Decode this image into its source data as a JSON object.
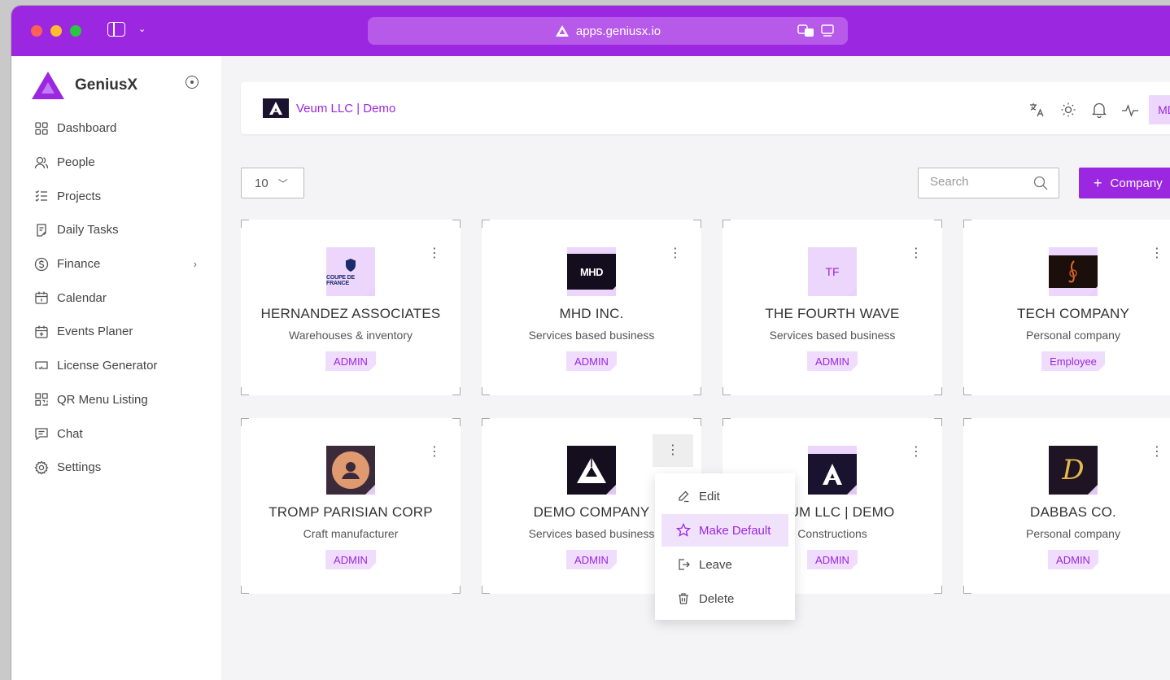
{
  "browser": {
    "url": "apps.geniusx.io"
  },
  "sidebar": {
    "brand": "GeniusX",
    "items": [
      {
        "label": "Dashboard",
        "icon": "dashboard-icon"
      },
      {
        "label": "People",
        "icon": "people-icon"
      },
      {
        "label": "Projects",
        "icon": "projects-icon"
      },
      {
        "label": "Daily Tasks",
        "icon": "daily-tasks-icon"
      },
      {
        "label": "Finance",
        "icon": "finance-icon"
      },
      {
        "label": "Calendar",
        "icon": "calendar-icon"
      },
      {
        "label": "Events Planer",
        "icon": "events-icon"
      },
      {
        "label": "License Generator",
        "icon": "license-icon"
      },
      {
        "label": "QR Menu Listing",
        "icon": "qr-icon"
      },
      {
        "label": "Chat",
        "icon": "chat-icon"
      },
      {
        "label": "Settings",
        "icon": "settings-icon"
      }
    ]
  },
  "topbar": {
    "org_name": "Veum LLC | Demo",
    "avatar": "MD"
  },
  "toolbar": {
    "per_page": "10",
    "search_placeholder": "Search",
    "add_label": "Company"
  },
  "cards": [
    {
      "name": "HERNANDEZ ASSOCIATES",
      "type": "Warehouses & inventory",
      "role": "ADMIN",
      "logo_text": "COUPE DE FRANCE"
    },
    {
      "name": "MHD INC.",
      "type": "Services based business",
      "role": "ADMIN",
      "logo_text": "MHD"
    },
    {
      "name": "THE FOURTH WAVE",
      "type": "Services based business",
      "role": "ADMIN",
      "logo_text": "TF"
    },
    {
      "name": "TECH COMPANY",
      "type": "Personal company",
      "role": "Employee",
      "logo_text": ""
    },
    {
      "name": "TROMP PARISIAN CORP",
      "type": "Craft manufacturer",
      "role": "ADMIN",
      "logo_text": ""
    },
    {
      "name": "DEMO COMPANY",
      "type": "Services based business",
      "role": "ADMIN",
      "logo_text": ""
    },
    {
      "name": "VEUM LLC | DEMO",
      "type": "Constructions",
      "role": "ADMIN",
      "logo_text": ""
    },
    {
      "name": "DABBAS CO.",
      "type": "Personal company",
      "role": "ADMIN",
      "logo_text": "D"
    }
  ],
  "menu": {
    "items": [
      {
        "label": "Edit",
        "icon": "edit-icon"
      },
      {
        "label": "Make Default",
        "icon": "star-icon"
      },
      {
        "label": "Leave",
        "icon": "leave-icon"
      },
      {
        "label": "Delete",
        "icon": "trash-icon"
      }
    ]
  },
  "colors": {
    "accent": "#9b27e0",
    "accent_light": "#f0dcfc"
  }
}
